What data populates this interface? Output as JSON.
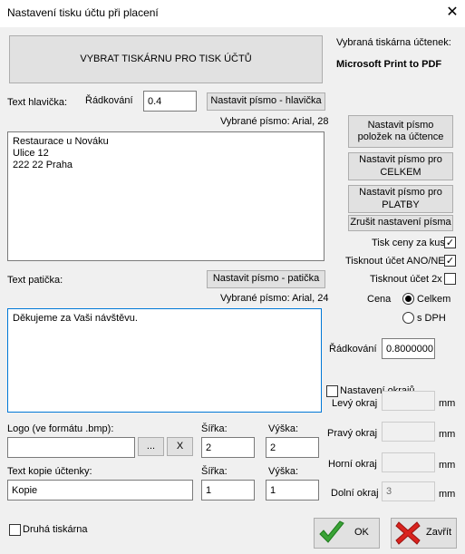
{
  "window": {
    "title": "Nastavení tisku účtu při placení"
  },
  "printer": {
    "select_button": "VYBRAT TISKÁRNU PRO TISK ÚČTŮ",
    "selected_label": "Vybraná tiskárna účtenek:",
    "selected_value": "Microsoft Print to PDF"
  },
  "header": {
    "label": "Text hlavička:",
    "spacing_label": "Řádkování",
    "spacing_value": "0.4",
    "font_button": "Nastavit písmo - hlavička",
    "font_info": "Vybrané písmo: Arial, 28",
    "text": "Restaurace u Nováku\nUlice 12\n222 22 Praha"
  },
  "footer": {
    "label": "Text patička:",
    "font_button": "Nastavit písmo - patička",
    "font_info": "Vybrané písmo: Arial, 24",
    "text": "Děkujeme za Vaši návštěvu."
  },
  "font_buttons": {
    "items": "Nastavit písmo\npoložek na účtence",
    "total": "Nastavit písmo pro\nCELKEM",
    "payment": "Nastavit písmo pro\nPLATBY",
    "reset": "Zrušit nastavení písma"
  },
  "options": {
    "unit_price_label": "Tisk ceny za kus",
    "unit_price_checked": true,
    "print_receipt_label": "Tisknout účet ANO/NE",
    "print_receipt_checked": true,
    "print_twice_label": "Tisknout účet 2x",
    "print_twice_checked": false,
    "price_label": "Cena",
    "price_options": [
      "Celkem",
      "s DPH"
    ],
    "price_selected": "Celkem",
    "line_spacing_label": "Řádkování",
    "line_spacing_value": "0.8000000"
  },
  "margins": {
    "checkbox_label": "Nastavení okrajů",
    "checked": false,
    "left_label": "Levý okraj",
    "left_value": "",
    "right_label": "Pravý okraj",
    "right_value": "",
    "top_label": "Horní okraj",
    "top_value": "",
    "bottom_label": "Dolní okraj",
    "bottom_value": "3",
    "unit": "mm"
  },
  "logo": {
    "label": "Logo (ve formátu .bmp):",
    "path_value": "",
    "browse_button": "...",
    "clear_button": "X",
    "width_label": "Šířka:",
    "width_value": "2",
    "height_label": "Výška:",
    "height_value": "2"
  },
  "copy": {
    "label": "Text kopie účtenky:",
    "value": "Kopie",
    "width_label": "Šířka:",
    "width_value": "1",
    "height_label": "Výška:",
    "height_value": "1"
  },
  "second_printer": {
    "label": "Druhá tiskárna",
    "checked": false
  },
  "actions": {
    "ok": "OK",
    "close": "Zavřít"
  },
  "colors": {
    "accent": "#0078d7",
    "ok_green": "#3aa336",
    "close_red": "#d9231e"
  }
}
